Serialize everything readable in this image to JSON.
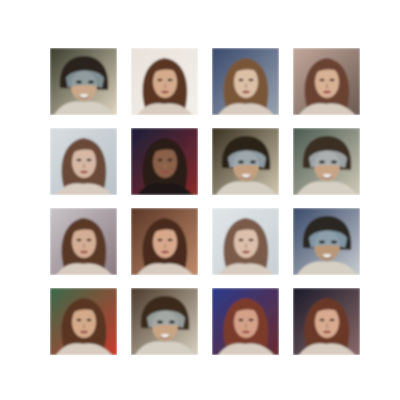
{
  "grid": {
    "rows": 4,
    "cols": 4,
    "tiles": [
      {
        "bg": "#3a3d2e",
        "bg2": "#e0d6c0",
        "hair": "#2a221a",
        "skin": "#c9a88a",
        "overlay": "#8a9aa0",
        "variant": "dark-mask"
      },
      {
        "bg": "#e8e2dc",
        "bg2": "#f4efe8",
        "hair": "#5a3422",
        "skin": "#d4ab8c",
        "overlay": "",
        "variant": "long-hair"
      },
      {
        "bg": "#3a4a6e",
        "bg2": "#9aa4b0",
        "hair": "#7a5638",
        "skin": "#dcc0a6",
        "overlay": "",
        "variant": "long-hair"
      },
      {
        "bg": "#c2a69a",
        "bg2": "#6a5a52",
        "hair": "#6a4230",
        "skin": "#d8b094",
        "overlay": "",
        "variant": "long-hair"
      },
      {
        "bg": "#d8dde0",
        "bg2": "#b8c2c8",
        "hair": "#6a4a38",
        "skin": "#d6b8a4",
        "overlay": "",
        "variant": "long-hair"
      },
      {
        "bg": "#1a1e3a",
        "bg2": "#8a2a2a",
        "hair": "#2a1a14",
        "skin": "#8a6048",
        "overlay": "",
        "variant": "dark-long"
      },
      {
        "bg": "#3a3020",
        "bg2": "#d0c8b0",
        "hair": "#2a2218",
        "skin": "#c4a080",
        "overlay": "#9aa8b0",
        "variant": "dark-mask"
      },
      {
        "bg": "#4a5a50",
        "bg2": "#d0cab8",
        "hair": "#3a2e22",
        "skin": "#c8a486",
        "overlay": "#a8b0b4",
        "variant": "dark-mask"
      },
      {
        "bg": "#c8c4c8",
        "bg2": "#8a7a80",
        "hair": "#5a3828",
        "skin": "#d4ae94",
        "overlay": "",
        "variant": "long-hair"
      },
      {
        "bg": "#5a3828",
        "bg2": "#c08a6a",
        "hair": "#4a2a1c",
        "skin": "#d8a88c",
        "overlay": "",
        "variant": "long-hair"
      },
      {
        "bg": "#e0e6e8",
        "bg2": "#c8d0d4",
        "hair": "#7a5a48",
        "skin": "#dcc0ac",
        "overlay": "",
        "variant": "long-hair"
      },
      {
        "bg": "#3a4a6a",
        "bg2": "#c8ccd0",
        "hair": "#2a2824",
        "skin": "#b89878",
        "overlay": "#8aa0b0",
        "variant": "dark-mask"
      },
      {
        "bg": "#3a6a4a",
        "bg2": "#c83a2a",
        "hair": "#5a3420",
        "skin": "#d4aa8a",
        "overlay": "",
        "variant": "long-hair"
      },
      {
        "bg": "#4a3a2a",
        "bg2": "#d8d0c0",
        "hair": "#3a2a1c",
        "skin": "#c8a484",
        "overlay": "#a0a8a8",
        "variant": "dark-mask"
      },
      {
        "bg": "#2a3a8a",
        "bg2": "#6a2a30",
        "hair": "#7a3a2a",
        "skin": "#d4a088",
        "overlay": "",
        "variant": "long-hair"
      },
      {
        "bg": "#1a1a2a",
        "bg2": "#8a6a6a",
        "hair": "#6a3828",
        "skin": "#d8aa90",
        "overlay": "",
        "variant": "long-hair"
      }
    ]
  }
}
